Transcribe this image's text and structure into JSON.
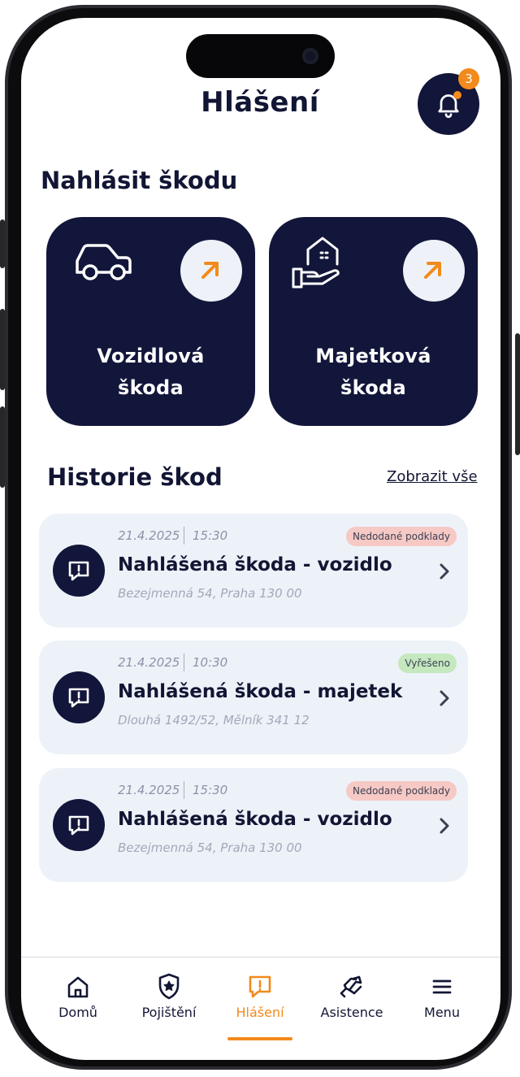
{
  "header": {
    "title": "Hlášení",
    "notification_count": "3"
  },
  "report": {
    "title": "Nahlásit škodu",
    "tiles": [
      {
        "label_line1": "Vozidlová",
        "label_line2": "škoda",
        "icon": "car-icon"
      },
      {
        "label_line1": "Majetková",
        "label_line2": "škoda",
        "icon": "property-hand-icon"
      }
    ]
  },
  "history": {
    "title": "Historie škod",
    "show_all": "Zobrazit vše",
    "items": [
      {
        "date": "21.4.2025",
        "time": "15:30",
        "title": "Nahlášená škoda - vozidlo",
        "address": "Bezejmenná 54, Praha 130 00",
        "status": "Nedodané podklady",
        "status_color": "#f6c9c5"
      },
      {
        "date": "21.4.2025",
        "time": "10:30",
        "title": "Nahlášená škoda - majetek",
        "address": "Dlouhá 1492/52, Mělník 341 12",
        "status": "Vyřešeno",
        "status_color": "#c5e8bf"
      },
      {
        "date": "21.4.2025",
        "time": "15:30",
        "title": "Nahlášená škoda - vozidlo",
        "address": "Bezejmenná 54, Praha 130 00",
        "status": "Nedodané podklady",
        "status_color": "#f6c9c5"
      }
    ]
  },
  "tabbar": {
    "items": [
      {
        "label": "Domů",
        "icon": "home-icon"
      },
      {
        "label": "Pojištění",
        "icon": "shield-star-icon"
      },
      {
        "label": "Hlášení",
        "icon": "report-icon",
        "active": true
      },
      {
        "label": "Asistence",
        "icon": "assistance-icon"
      },
      {
        "label": "Menu",
        "icon": "menu-icon"
      }
    ]
  },
  "colors": {
    "navy": "#12163a",
    "accent": "#f28a1c",
    "card_bg": "#edf2f9"
  }
}
